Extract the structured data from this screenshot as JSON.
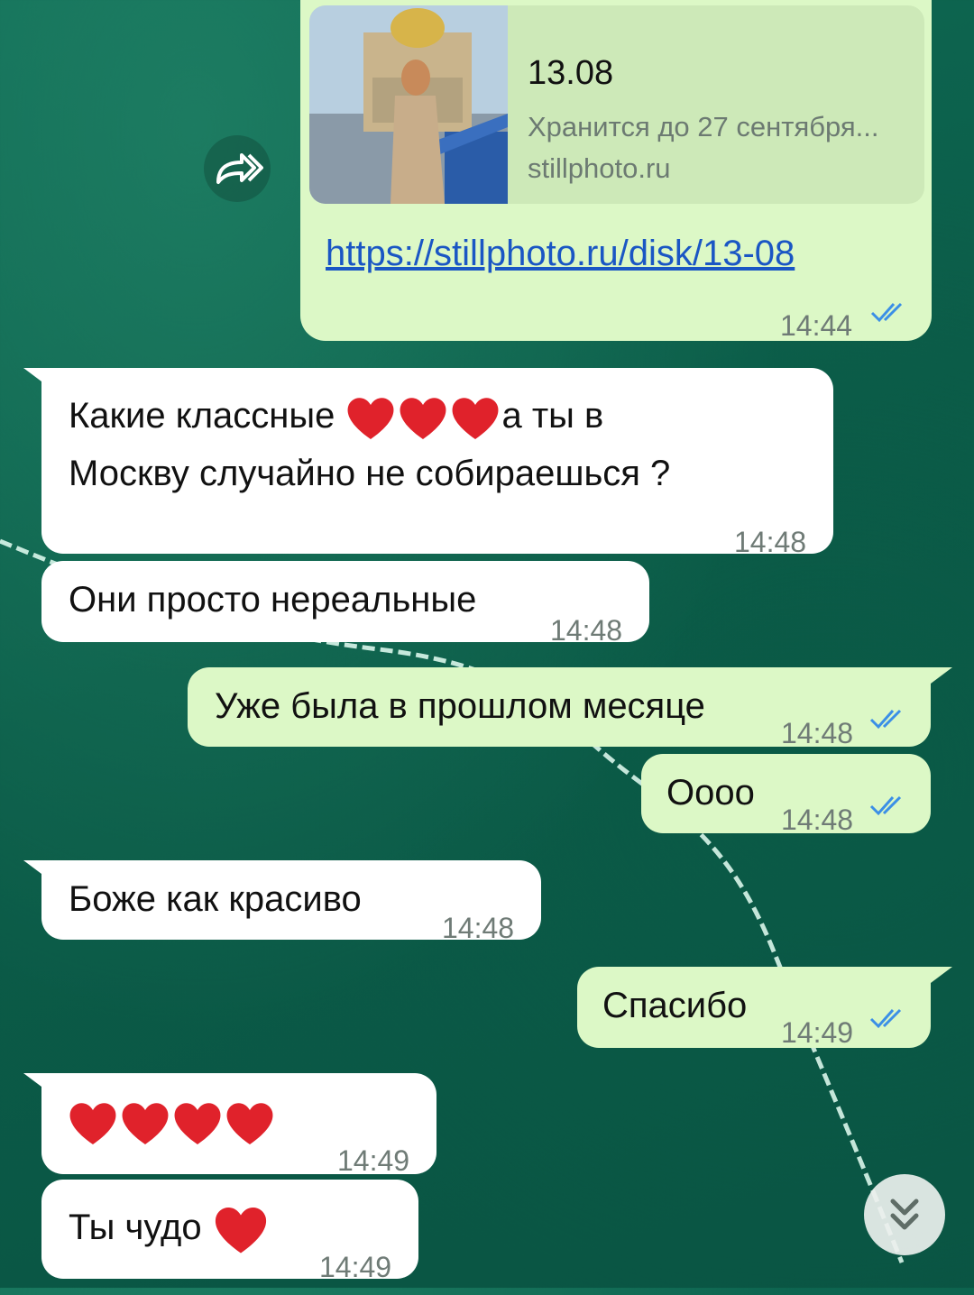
{
  "link_preview": {
    "title": "13.08",
    "description": "Хранится до 27 сентября...",
    "domain": "stillphoto.ru",
    "url": "https://stillphoto.ru/disk/13-08",
    "time": "14:44"
  },
  "messages": [
    {
      "text_before": "Какие классные ",
      "text_after": "а ты в",
      "line2": "Москву случайно не собираешься ?",
      "time": "14:48"
    },
    {
      "text": "Они просто нереальные",
      "time": "14:48"
    },
    {
      "text": "Уже была в прошлом месяце",
      "time": "14:48"
    },
    {
      "text": "Оооо",
      "time": "14:48"
    },
    {
      "text": "Боже как красиво",
      "time": "14:48"
    },
    {
      "text": "Спасибо",
      "time": "14:49"
    },
    {
      "text": "",
      "time": "14:49"
    },
    {
      "text": "Ты чудо ",
      "time": "14:49"
    }
  ],
  "icons": {
    "forward": "forward-icon",
    "scroll_down": "double-chevron-down-icon",
    "heart": "heart-icon",
    "read_ticks": "double-check-icon"
  },
  "colors": {
    "outgoing_bubble": "#dcf8c6",
    "incoming_bubble": "#ffffff",
    "link": "#1a56c4",
    "ticks": "#3b8fe6",
    "background": "#0b5c48"
  }
}
